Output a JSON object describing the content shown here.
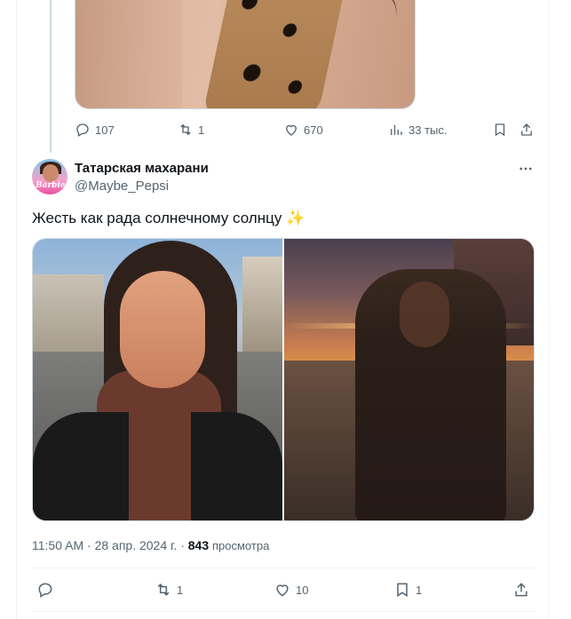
{
  "previous_tweet": {
    "replies": "107",
    "reposts": "1",
    "likes": "670",
    "views": "33 тыс."
  },
  "tweet": {
    "author_name": "Татарская махарани",
    "author_handle": "@Maybe_Pepsi",
    "avatar_text": "Barbie",
    "text": "Жесть как рада солнечному солнцу",
    "emoji": "✨",
    "time": "11:50 AM",
    "date": "28 апр. 2024 г.",
    "separator": "·",
    "views_count": "843",
    "views_label": "просмотра",
    "replies": "",
    "reposts": "1",
    "likes": "10",
    "bookmarks": "1"
  },
  "icons": {
    "reply": "reply-icon",
    "repost": "repost-icon",
    "like": "heart-icon",
    "views": "views-chart-icon",
    "bookmark": "bookmark-icon",
    "share": "share-icon",
    "more": "more-dots-icon"
  },
  "colors": {
    "text_primary": "#0f1419",
    "text_secondary": "#536471",
    "border": "#eff3f4"
  }
}
